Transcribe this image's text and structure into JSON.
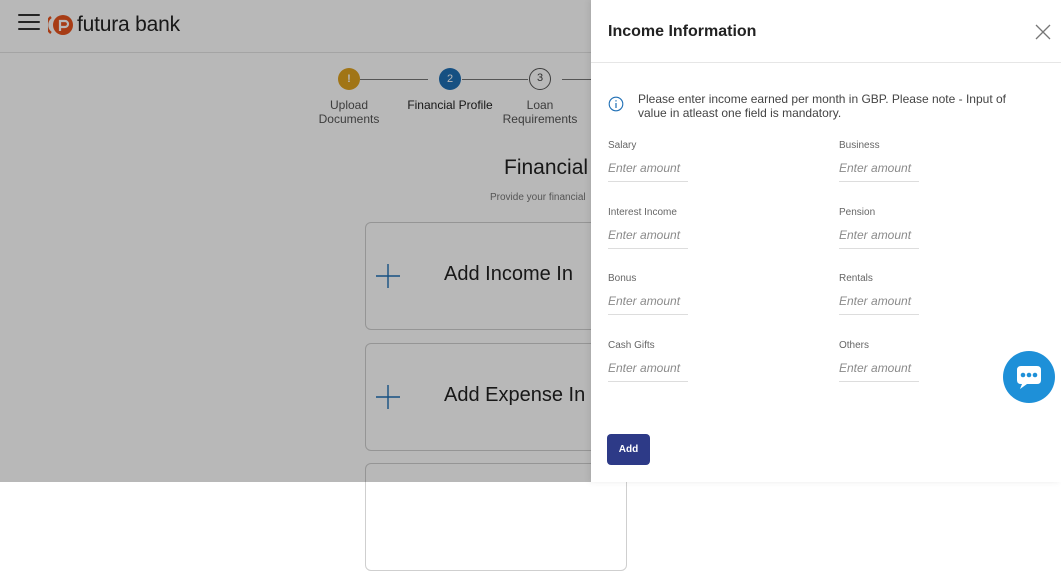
{
  "header": {
    "brand": "futura bank"
  },
  "stepper": {
    "steps": [
      {
        "number": "!",
        "label": "Upload Documents",
        "state": "warning"
      },
      {
        "number": "2",
        "label": "Financial Profile",
        "state": "active"
      },
      {
        "number": "3",
        "label": "Loan Requirements",
        "state": "pending"
      }
    ]
  },
  "background": {
    "title": "Financial",
    "subtitle": "Provide your financial",
    "cards": [
      {
        "label": "Add Income In"
      },
      {
        "label": "Add Expense In"
      }
    ]
  },
  "panel": {
    "title": "Income Information",
    "info": "Please enter income earned per month in GBP. Please note - Input of value in atleast one field is mandatory.",
    "fields": [
      {
        "label": "Salary",
        "placeholder": "Enter amount"
      },
      {
        "label": "Business",
        "placeholder": "Enter amount"
      },
      {
        "label": "Interest Income",
        "placeholder": "Enter amount"
      },
      {
        "label": "Pension",
        "placeholder": "Enter amount"
      },
      {
        "label": "Bonus",
        "placeholder": "Enter amount"
      },
      {
        "label": "Rentals",
        "placeholder": "Enter amount"
      },
      {
        "label": "Cash Gifts",
        "placeholder": "Enter amount"
      },
      {
        "label": "Others",
        "placeholder": "Enter amount"
      }
    ],
    "add_label": "Add"
  },
  "colors": {
    "primary_button": "#2d3a87",
    "chat_button": "#1e90d8",
    "step_warning": "#e0a21f",
    "step_active": "#1f6fb5"
  },
  "icons": [
    "menu-icon",
    "futura-logo-icon",
    "plus-icon",
    "close-icon",
    "info-icon",
    "chat-icon"
  ]
}
